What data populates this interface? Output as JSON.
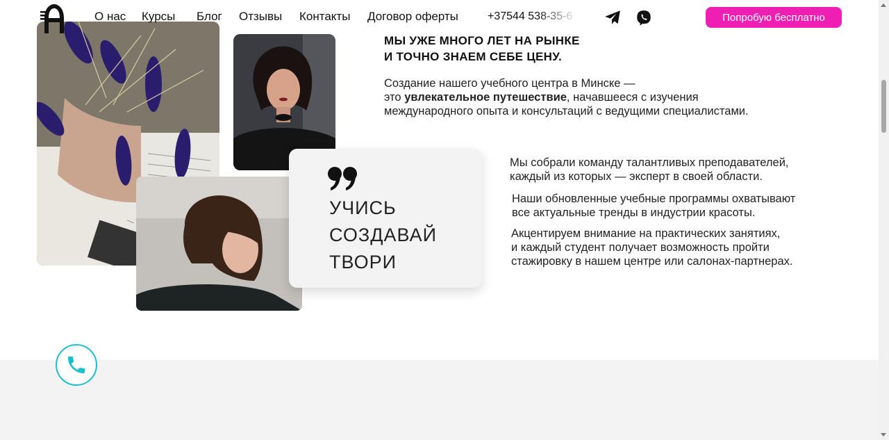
{
  "header": {
    "nav": [
      "О нас",
      "Курсы",
      "Блог",
      "Отзывы",
      "Контакты",
      "Договор оферты"
    ],
    "phone": "+37544 538-35-6",
    "cta": "Попробую бесплатно",
    "accent_color": "#f01fb4"
  },
  "icons": {
    "logo": "logo-a",
    "telegram": "telegram-icon",
    "viber": "viber-icon",
    "call": "phone-icon",
    "quote": "quote-icon"
  },
  "headline": {
    "line1": "МЫ УЖЕ МНОГО ЛЕТ НА РЫНКЕ",
    "line2": "И ТОЧНО ЗНАЕМ СЕБЕ ЦЕНУ."
  },
  "intro": {
    "line1": "Создание нашего учебного центра в Минске —",
    "line2_prefix": "это ",
    "line2_bold": "увлекательное путешествие",
    "line2_suffix": ", начавшееся с изучения",
    "line3": "международного опыта и консультаций с ведущими специалистами."
  },
  "quote": {
    "mark": "❞",
    "lines": [
      "УЧИСЬ",
      "СОЗДАВАЙ",
      "ТВОРИ"
    ]
  },
  "paragraphs": [
    [
      "Мы собрали команду талантливых преподавателей,",
      "каждый из которых — эксперт в своей области."
    ],
    [
      "Наши обновленные учебные программы охватывают",
      "все актуальные тренды в индустрии красоты."
    ],
    [
      "Акцентируем внимание на практических занятиях,",
      "и каждый студент получает возможность пройти",
      "стажировку в нашем центре или салонах-партнерах."
    ]
  ],
  "call_color": "#18c0cf"
}
